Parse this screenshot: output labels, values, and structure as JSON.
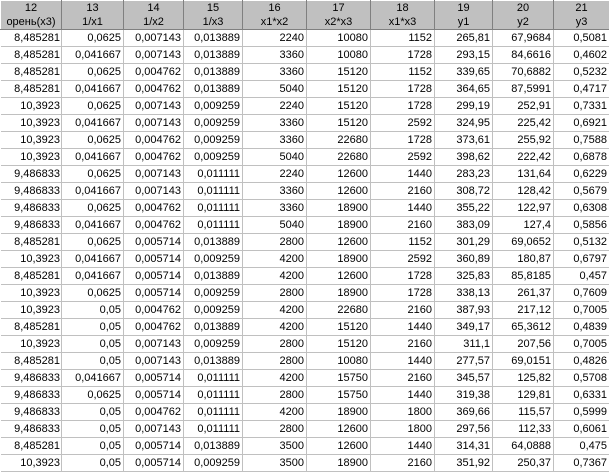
{
  "columns": [
    {
      "num": "12",
      "name": "орень(x3)"
    },
    {
      "num": "13",
      "name": "1/x1"
    },
    {
      "num": "14",
      "name": "1/x2"
    },
    {
      "num": "15",
      "name": "1/x3"
    },
    {
      "num": "16",
      "name": "x1*x2"
    },
    {
      "num": "17",
      "name": "x2*x3"
    },
    {
      "num": "18",
      "name": "x1*x3"
    },
    {
      "num": "19",
      "name": "y1"
    },
    {
      "num": "20",
      "name": "y2"
    },
    {
      "num": "21",
      "name": "y3"
    }
  ],
  "rows": [
    [
      "8,485281",
      "0,0625",
      "0,007143",
      "0,013889",
      "2240",
      "10080",
      "1152",
      "265,81",
      "67,9684",
      "0,5081"
    ],
    [
      "8,485281",
      "0,041667",
      "0,007143",
      "0,013889",
      "3360",
      "10080",
      "1728",
      "293,15",
      "84,6616",
      "0,4602"
    ],
    [
      "8,485281",
      "0,0625",
      "0,004762",
      "0,013889",
      "3360",
      "15120",
      "1152",
      "339,65",
      "70,6882",
      "0,5232"
    ],
    [
      "8,485281",
      "0,041667",
      "0,004762",
      "0,013889",
      "5040",
      "15120",
      "1728",
      "364,65",
      "87,5991",
      "0,4717"
    ],
    [
      "10,3923",
      "0,0625",
      "0,007143",
      "0,009259",
      "2240",
      "15120",
      "1728",
      "299,19",
      "252,91",
      "0,7331"
    ],
    [
      "10,3923",
      "0,041667",
      "0,007143",
      "0,009259",
      "3360",
      "15120",
      "2592",
      "324,95",
      "225,42",
      "0,6921"
    ],
    [
      "10,3923",
      "0,0625",
      "0,004762",
      "0,009259",
      "3360",
      "22680",
      "1728",
      "373,61",
      "255,92",
      "0,7588"
    ],
    [
      "10,3923",
      "0,041667",
      "0,004762",
      "0,009259",
      "5040",
      "22680",
      "2592",
      "398,62",
      "222,42",
      "0,6878"
    ],
    [
      "9,486833",
      "0,0625",
      "0,007143",
      "0,011111",
      "2240",
      "12600",
      "1440",
      "283,23",
      "131,64",
      "0,6229"
    ],
    [
      "9,486833",
      "0,041667",
      "0,007143",
      "0,011111",
      "3360",
      "12600",
      "2160",
      "308,72",
      "128,42",
      "0,5679"
    ],
    [
      "9,486833",
      "0,0625",
      "0,004762",
      "0,011111",
      "3360",
      "18900",
      "1440",
      "355,22",
      "122,97",
      "0,6308"
    ],
    [
      "9,486833",
      "0,041667",
      "0,004762",
      "0,011111",
      "5040",
      "18900",
      "2160",
      "383,09",
      "127,4",
      "0,5856"
    ],
    [
      "8,485281",
      "0,0625",
      "0,005714",
      "0,013889",
      "2800",
      "12600",
      "1152",
      "301,29",
      "69,0652",
      "0,5132"
    ],
    [
      "10,3923",
      "0,041667",
      "0,005714",
      "0,009259",
      "4200",
      "18900",
      "2592",
      "360,89",
      "180,87",
      "0,6797"
    ],
    [
      "8,485281",
      "0,041667",
      "0,005714",
      "0,013889",
      "4200",
      "12600",
      "1728",
      "325,83",
      "85,8185",
      "0,457"
    ],
    [
      "10,3923",
      "0,0625",
      "0,005714",
      "0,009259",
      "2800",
      "18900",
      "1728",
      "338,13",
      "261,37",
      "0,7609"
    ],
    [
      "10,3923",
      "0,05",
      "0,004762",
      "0,009259",
      "4200",
      "22680",
      "2160",
      "387,93",
      "217,12",
      "0,7005"
    ],
    [
      "8,485281",
      "0,05",
      "0,004762",
      "0,013889",
      "4200",
      "15120",
      "1440",
      "349,17",
      "65,3612",
      "0,4839"
    ],
    [
      "10,3923",
      "0,05",
      "0,007143",
      "0,009259",
      "2800",
      "15120",
      "2160",
      "311,1",
      "207,56",
      "0,7005"
    ],
    [
      "8,485281",
      "0,05",
      "0,007143",
      "0,013889",
      "2800",
      "10080",
      "1440",
      "277,57",
      "69,0151",
      "0,4826"
    ],
    [
      "9,486833",
      "0,041667",
      "0,005714",
      "0,011111",
      "4200",
      "15750",
      "2160",
      "345,57",
      "125,82",
      "0,5708"
    ],
    [
      "9,486833",
      "0,0625",
      "0,005714",
      "0,011111",
      "2800",
      "15750",
      "1440",
      "319,38",
      "129,81",
      "0,6331"
    ],
    [
      "9,486833",
      "0,05",
      "0,004762",
      "0,011111",
      "4200",
      "18900",
      "1800",
      "369,66",
      "115,57",
      "0,5999"
    ],
    [
      "9,486833",
      "0,05",
      "0,007143",
      "0,011111",
      "2800",
      "12600",
      "1800",
      "297,56",
      "112,33",
      "0,6061"
    ],
    [
      "8,485281",
      "0,05",
      "0,005714",
      "0,013889",
      "3500",
      "12600",
      "1440",
      "314,31",
      "64,0888",
      "0,475"
    ],
    [
      "10,3923",
      "0,05",
      "0,005714",
      "0,009259",
      "3500",
      "18900",
      "2160",
      "351,92",
      "250,37",
      "0,7367"
    ]
  ]
}
